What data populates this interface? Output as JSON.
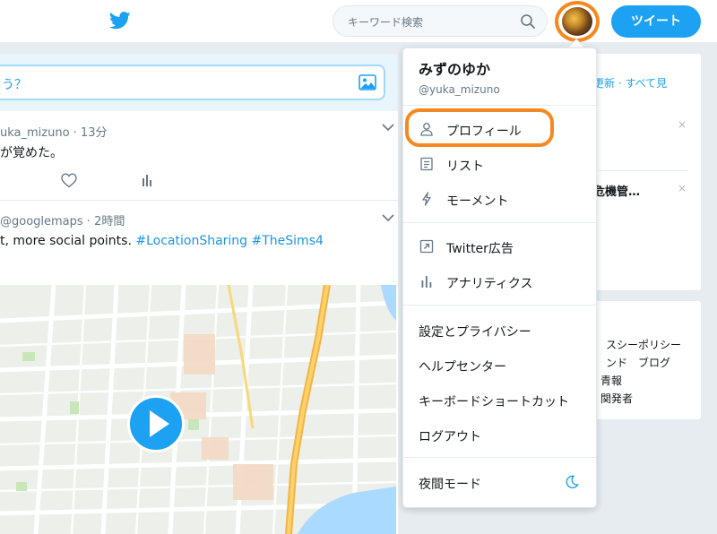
{
  "header": {
    "search_placeholder": "キーワード検索",
    "tweet_button": "ツイート",
    "icons": {
      "logo": "twitter-bird-icon",
      "search": "search-icon"
    },
    "colors": {
      "brand": "#1da1f2",
      "highlight": "#f5891f"
    }
  },
  "composer": {
    "prompt": "う？"
  },
  "tweets": [
    {
      "head": "uka_mizuno · 13分",
      "body": "が覚めた。"
    },
    {
      "head": "@googlemaps · 2時間",
      "body_plain": "t, more social points. ",
      "hashtag1": "#LocationSharing",
      "hashtag2": "#TheSims4"
    }
  ],
  "right_column": {
    "trends_header": "更新 · すべて見",
    "trend_item": "危機管…",
    "footer_lines": [
      "スシーポリシー",
      "ンド　ブログ",
      "青報",
      "関発者"
    ]
  },
  "dropdown": {
    "user_name": "みずのゆか",
    "user_handle": "@yuka_mizuno",
    "group1": [
      {
        "label": "プロフィール",
        "icon": "person-icon"
      },
      {
        "label": "リスト",
        "icon": "list-icon"
      },
      {
        "label": "モーメント",
        "icon": "lightning-icon"
      }
    ],
    "group2": [
      {
        "label": "Twitter広告",
        "icon": "external-link-icon"
      },
      {
        "label": "アナリティクス",
        "icon": "bar-chart-icon"
      }
    ],
    "group3": [
      {
        "label": "設定とプライバシー"
      },
      {
        "label": "ヘルプセンター"
      },
      {
        "label": "キーボードショートカット"
      },
      {
        "label": "ログアウト"
      }
    ],
    "night_mode": {
      "label": "夜間モード",
      "icon": "moon-icon"
    }
  }
}
